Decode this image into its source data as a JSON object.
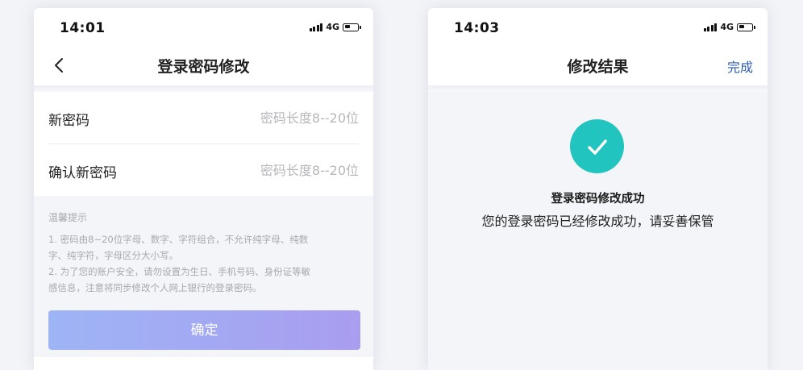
{
  "left_screen": {
    "status_bar": {
      "time": "14:01",
      "network": "4G"
    },
    "nav": {
      "title": "登录密码修改"
    },
    "form": {
      "new_password": {
        "label": "新密码",
        "placeholder": "密码长度8--20位",
        "value": ""
      },
      "confirm_password": {
        "label": "确认新密码",
        "placeholder": "密码长度8--20位",
        "value": ""
      }
    },
    "tips": {
      "title": "温馨提示",
      "lines": [
        "1. 密码由8~20位字母、数字、字符组合，不允许纯字母、纯数",
        "字、纯字符，字母区分大小写。",
        "2. 为了您的账户安全，请勿设置为生日、手机号码、身份证等敏",
        "感信息，注意将同步修改个人网上银行的登录密码。"
      ]
    },
    "confirm_label": "确定"
  },
  "right_screen": {
    "status_bar": {
      "time": "14:03",
      "network": "4G"
    },
    "nav": {
      "title": "修改结果",
      "done_label": "完成"
    },
    "result": {
      "icon": "check-icon",
      "title": "登录密码修改成功",
      "description": "您的登录密码已经修改成功，请妥善保管"
    }
  },
  "colors": {
    "success": "#22c4bf",
    "button_gradient_start": "#9db4f5",
    "button_gradient_end": "#a99df0",
    "link": "#2f5fb3"
  }
}
